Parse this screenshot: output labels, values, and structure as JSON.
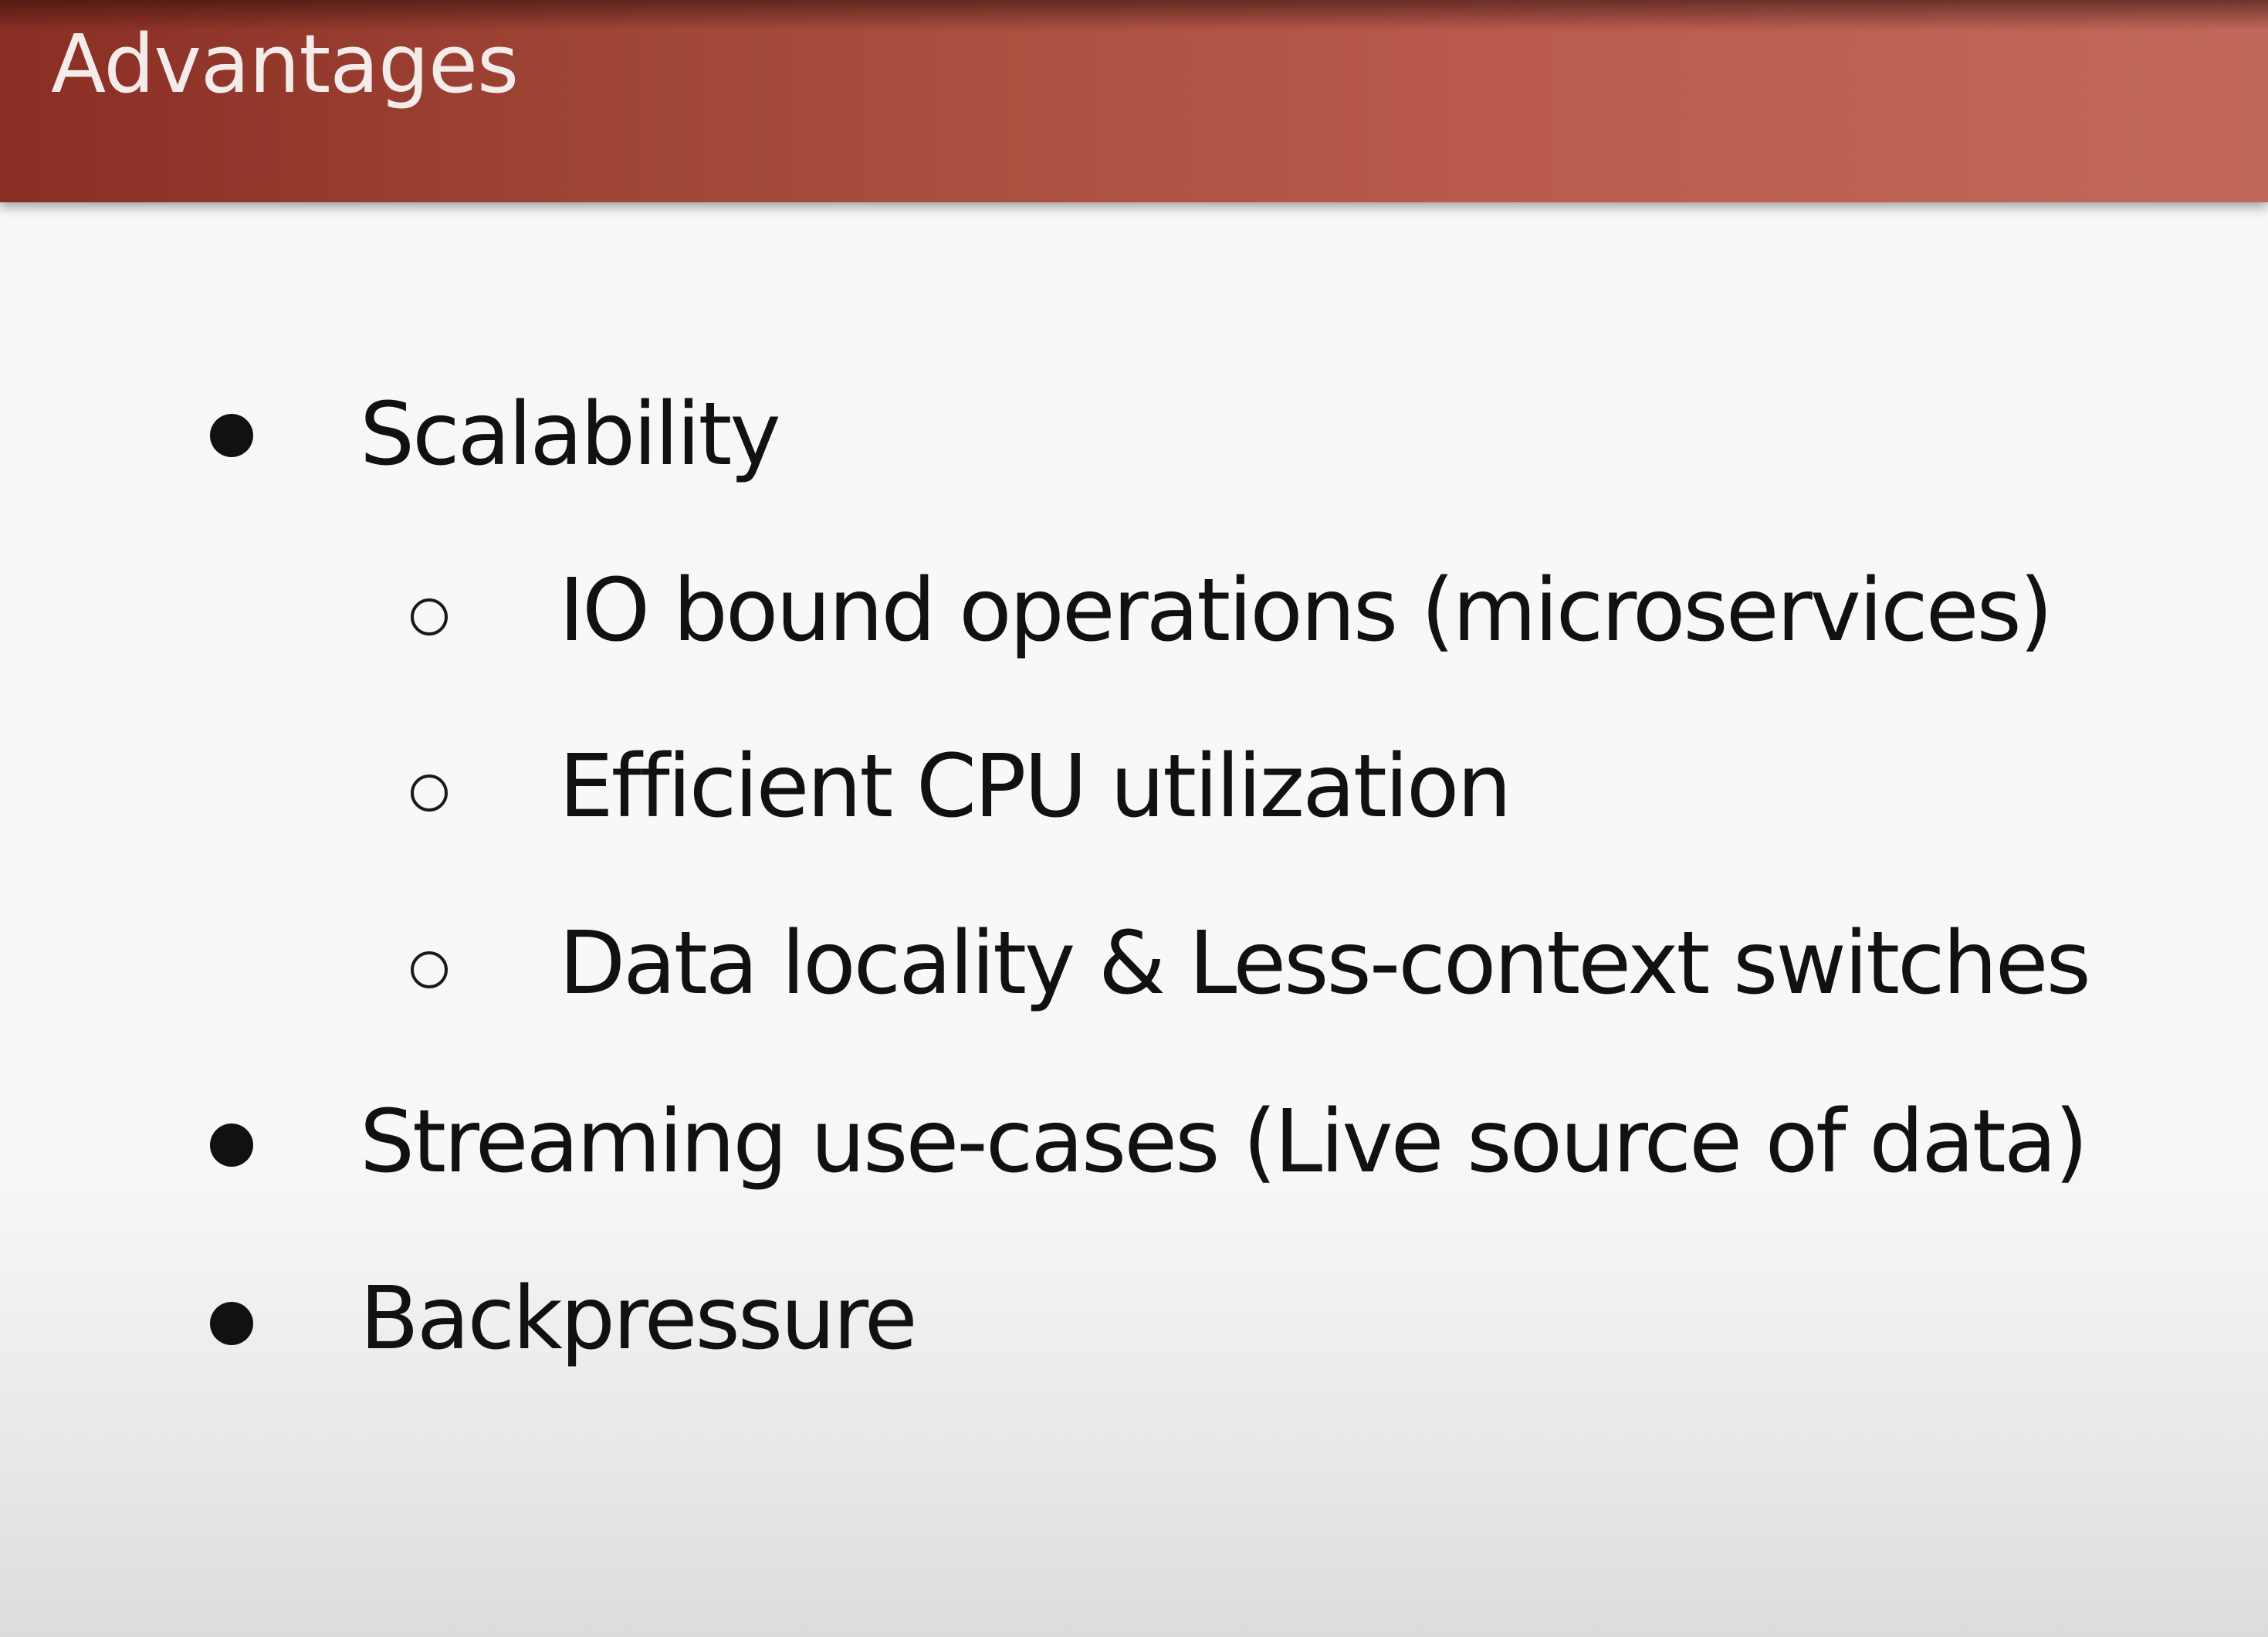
{
  "slide": {
    "title": "Advantages",
    "bullets": [
      {
        "level": 1,
        "text": "Scalability"
      },
      {
        "level": 2,
        "text": "IO bound operations (microservices)"
      },
      {
        "level": 2,
        "text": "Efficient CPU utilization"
      },
      {
        "level": 2,
        "text": "Data locality & Less-context switches"
      },
      {
        "level": 1,
        "text": "Streaming use-cases (Live source of data)"
      },
      {
        "level": 1,
        "text": "Backpressure"
      }
    ]
  },
  "colors": {
    "header_start": "#8a2e24",
    "header_end": "#c2685a",
    "title_text": "#f4ecea",
    "body_text": "#111111",
    "background": "#f7f7f7"
  }
}
